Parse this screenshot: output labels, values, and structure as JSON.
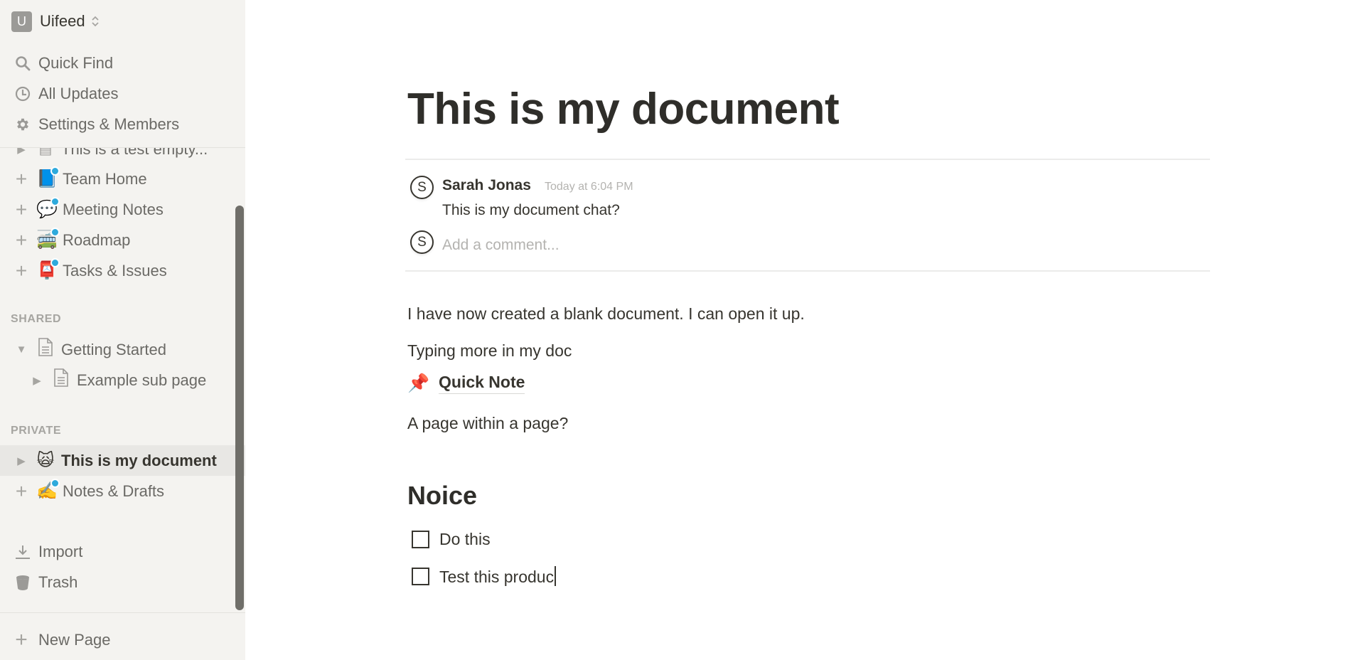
{
  "sidebar": {
    "workspace": {
      "initial": "U",
      "name": "Uifeed"
    },
    "nav": [
      {
        "label": "Quick Find",
        "icon": "search-icon"
      },
      {
        "label": "All Updates",
        "icon": "clock-icon"
      },
      {
        "label": "Settings & Members",
        "icon": "gear-icon"
      }
    ],
    "pages_top": [
      {
        "label": "This is a test empty...",
        "kind": "toggle",
        "icon": "document-icon"
      },
      {
        "label": "Team Home",
        "kind": "plus",
        "emoji": "📘"
      },
      {
        "label": "Meeting Notes",
        "kind": "plus",
        "emoji": "💬"
      },
      {
        "label": "Roadmap",
        "kind": "plus",
        "emoji": "🚎"
      },
      {
        "label": "Tasks & Issues",
        "kind": "plus",
        "emoji": "📮"
      }
    ],
    "shared_label": "SHARED",
    "shared": [
      {
        "label": "Getting Started",
        "expanded": true,
        "icon": "document-icon"
      },
      {
        "label": "Example sub page",
        "expanded": false,
        "icon": "document-icon"
      }
    ],
    "private_label": "PRIVATE",
    "private": [
      {
        "label": "This is my document",
        "emoji": "🙀",
        "selected": true
      },
      {
        "label": "Notes & Drafts",
        "emoji": "✍️",
        "selected": false
      }
    ],
    "footer": [
      {
        "label": "Import",
        "icon": "download-icon"
      },
      {
        "label": "Trash",
        "icon": "trash-icon"
      }
    ],
    "new_page": "New Page"
  },
  "page": {
    "title": "This is my document",
    "comments": [
      {
        "avatar": "S",
        "author": "Sarah Jonas",
        "time": "Today at 6:04 PM",
        "text": "This is my document chat?"
      }
    ],
    "comment_input": {
      "avatar": "S",
      "placeholder": "Add a comment...",
      "value": ""
    },
    "blocks": {
      "p1": "I have now created a blank document. I can open it up.",
      "p2": "Typing more in my doc",
      "link": {
        "emoji": "📌",
        "label": "Quick Note"
      },
      "p3": "A page within a page?",
      "heading": "Noice",
      "todos": [
        {
          "text": "Do this",
          "checked": false
        },
        {
          "text": "Test this produc",
          "checked": false
        }
      ]
    }
  }
}
